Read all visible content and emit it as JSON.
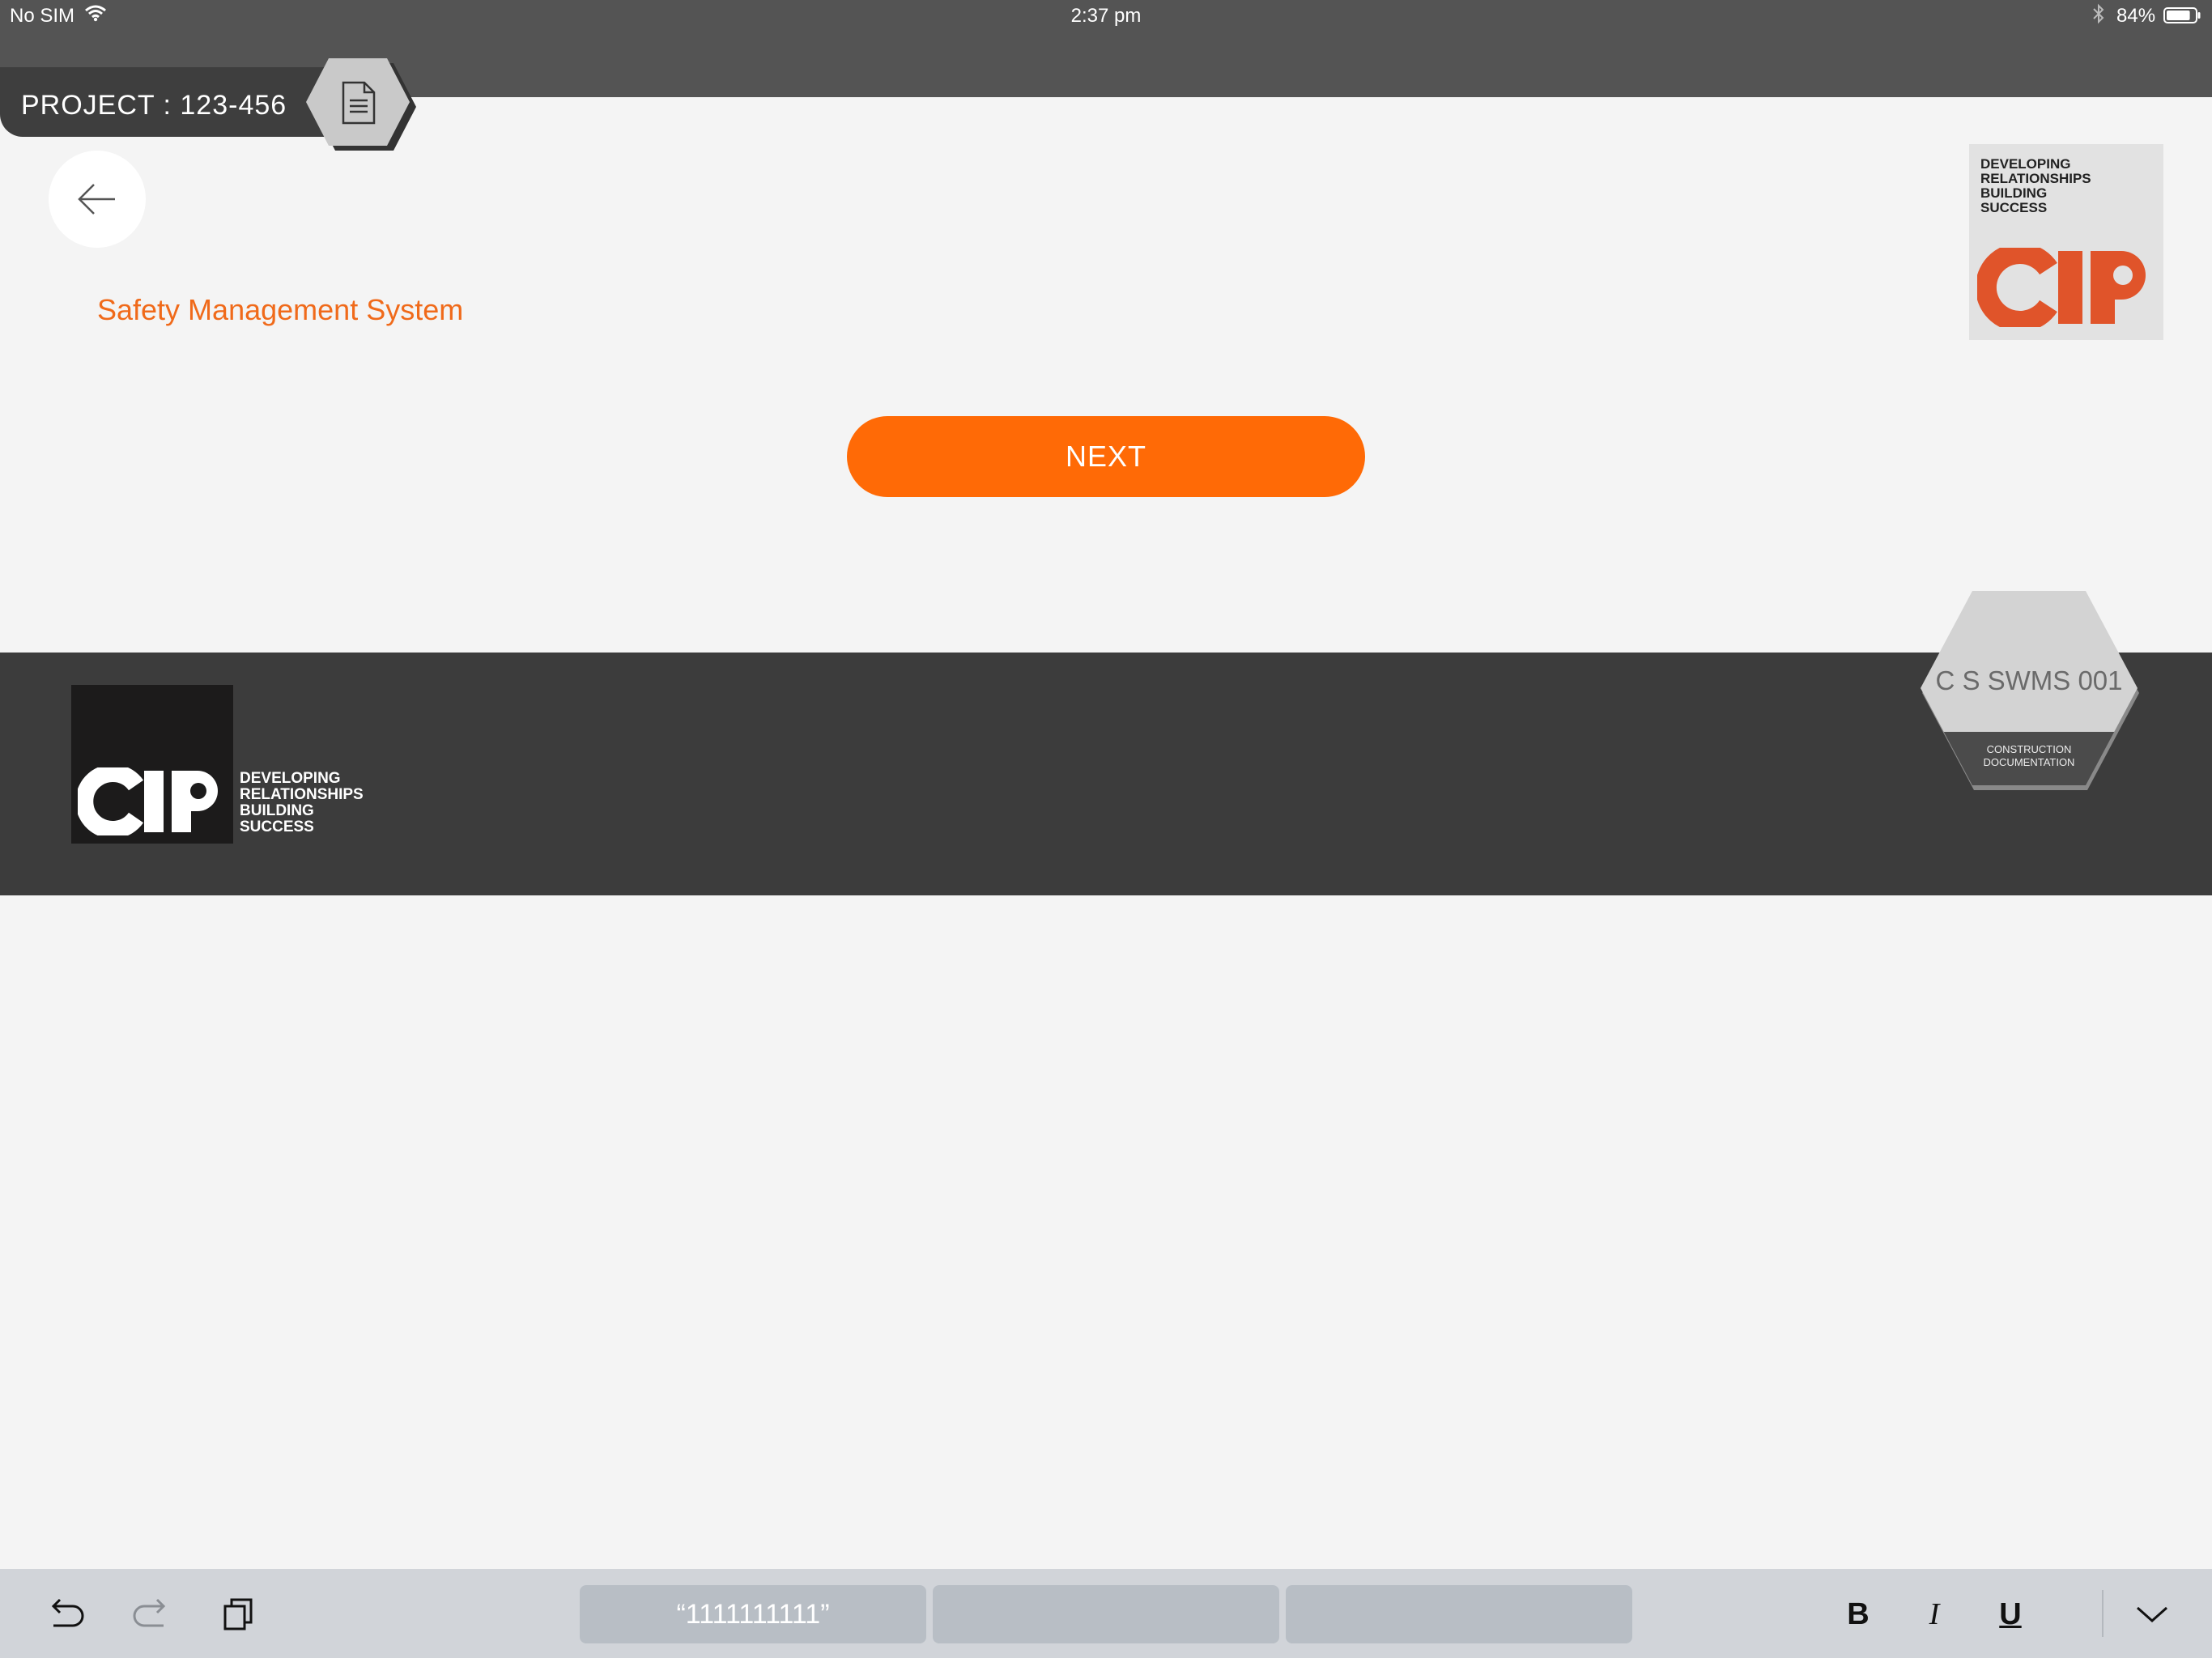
{
  "status_bar": {
    "carrier": "No SIM",
    "time": "2:37 pm",
    "battery": "84%",
    "battery_level": 0.84
  },
  "header": {
    "project_label": "PROJECT : 123-456"
  },
  "page": {
    "title": "Safety Management System",
    "next_label": "NEXT"
  },
  "logo": {
    "brand": "CIP",
    "tagline": [
      "DEVELOPING",
      "RELATIONSHIPS",
      "BUILDING",
      "SUCCESS"
    ],
    "brand_color": "#e0542a"
  },
  "doc_badge": {
    "code": "C S SWMS 001",
    "type_line1": "CONSTRUCTION",
    "type_line2": "DOCUMENTATION"
  },
  "keyboard_bar": {
    "suggestions": [
      "“1111111111”",
      "",
      ""
    ],
    "bold": "B",
    "italic": "I",
    "underline": "U"
  },
  "colors": {
    "accent": "#ff6a06",
    "title": "#f06a1a",
    "topbar": "#545454",
    "footer": "#3c3c3c"
  },
  "icons": [
    "wifi-icon",
    "bluetooth-icon",
    "battery-icon",
    "document-icon",
    "back-arrow-icon",
    "undo-icon",
    "redo-icon",
    "paste-icon",
    "chevron-down-icon"
  ]
}
